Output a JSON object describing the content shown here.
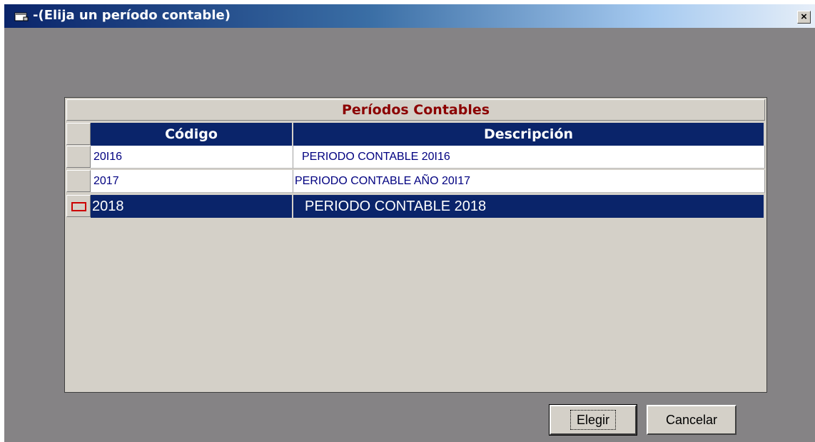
{
  "window": {
    "title": "-(Elija un período contable)",
    "icon": "app-window-icon",
    "close_symbol": "×"
  },
  "grid": {
    "caption": "Períodos Contables",
    "columns": [
      "Código",
      "Descripción"
    ],
    "rows": [
      {
        "codigo": "20I16",
        "descripcion": "PERIODO CONTABLE 20I16"
      },
      {
        "codigo": "2017",
        "descripcion": "PERIODO CONTABLE AÑO 20I17"
      },
      {
        "codigo": "2018",
        "descripcion": "PERIODO CONTABLE 2018",
        "selected": true
      }
    ]
  },
  "buttons": {
    "choose": "Elegir",
    "cancel": "Cancelar"
  },
  "colors": {
    "title_bar": "#0a246a",
    "caption_text": "#8b0000",
    "header_bg": "#0a246a",
    "selected_row_bg": "#0a246a",
    "row_text": "#000080",
    "client_bg": "#858385"
  }
}
